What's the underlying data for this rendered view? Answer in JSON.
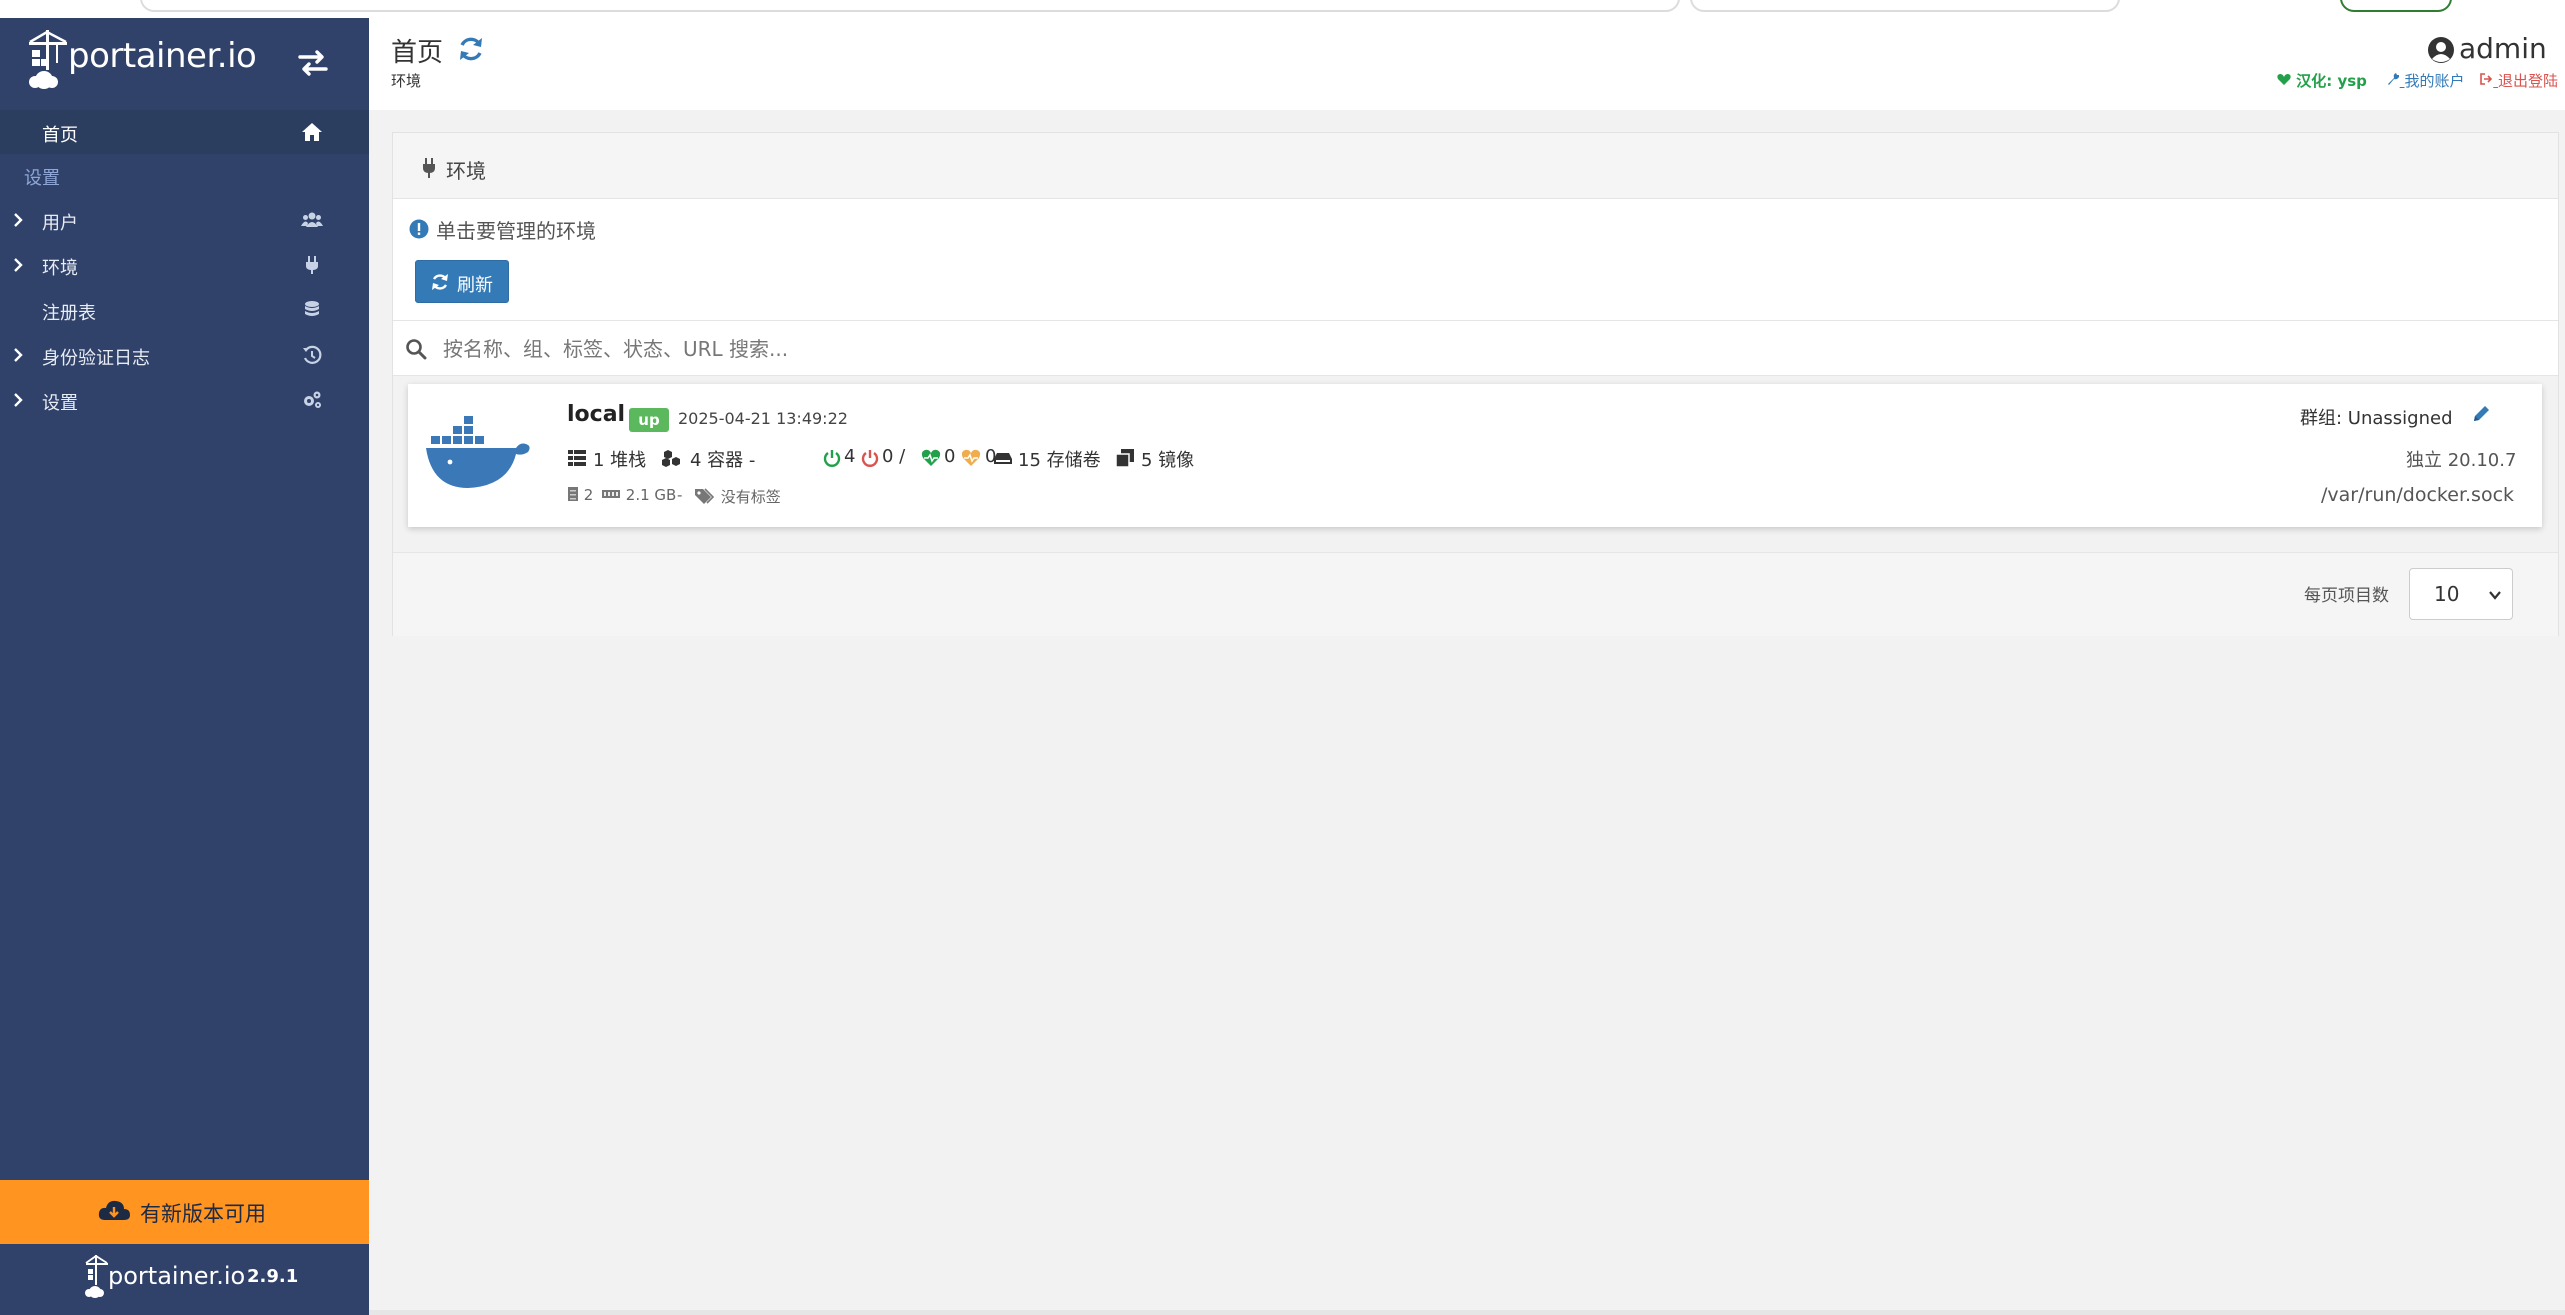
{
  "sidebar": {
    "brand": "portainer.io",
    "home_label": "首页",
    "section_label": "设置",
    "items": [
      {
        "label": "用户",
        "icon": "users-icon",
        "expandable": true
      },
      {
        "label": "环境",
        "icon": "plug-icon",
        "expandable": true
      },
      {
        "label": "注册表",
        "icon": "database-icon",
        "expandable": false
      },
      {
        "label": "身份验证日志",
        "icon": "history-icon",
        "expandable": true
      },
      {
        "label": "设置",
        "icon": "cogs-icon",
        "expandable": true
      }
    ],
    "update_label": "有新版本可用",
    "footer_brand": "portainer.io",
    "version": "2.9.1"
  },
  "header": {
    "title": "首页",
    "breadcrumb": "环境",
    "username": "admin",
    "credit": "汉化: ysp",
    "my_account": "我的账户",
    "logout": "退出登陆"
  },
  "widget": {
    "title": "环境",
    "info": "单击要管理的环境",
    "refresh_button": "刷新",
    "search_placeholder": "按名称、组、标签、状态、URL 搜索..."
  },
  "environment": {
    "name": "local",
    "status": "up",
    "timestamp": "2025-04-21 13:49:22",
    "stacks": "1 堆栈",
    "containers": "4 容器 -",
    "running": "4",
    "stopped": "0 /",
    "healthy": "0",
    "unhealthy": "0",
    "volumes": "15 存储卷",
    "images": "5 镜像",
    "cpu": "2",
    "memory": "2.1 GB",
    "separator": "-",
    "tags": "没有标签",
    "group": "群组: Unassigned",
    "version": "独立 20.10.7",
    "url": "/var/run/docker.sock"
  },
  "pagination": {
    "items_per_page_label": "每页项目数",
    "items_per_page_value": "10"
  },
  "colors": {
    "sidebar": "#30426a",
    "update": "#ff9421",
    "primary": "#337ab7",
    "success": "#5cb85c"
  }
}
